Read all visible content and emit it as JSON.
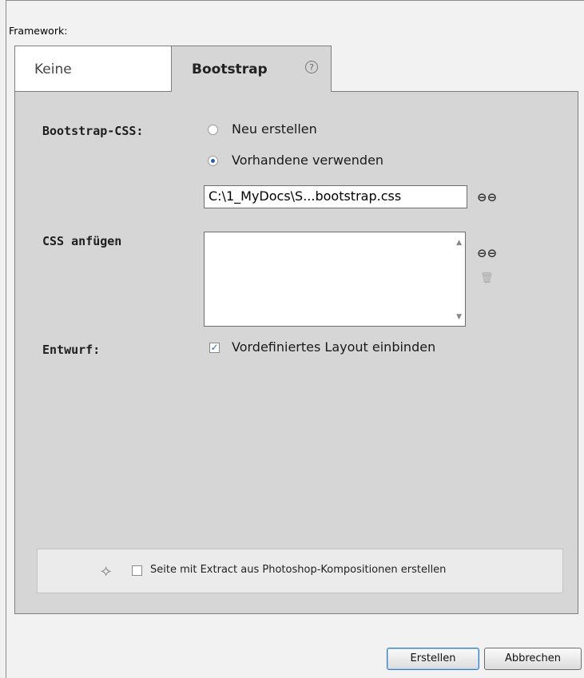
{
  "framework_label": "Framework:",
  "tabs": [
    {
      "label": "Keine",
      "active": false
    },
    {
      "label": "Bootstrap",
      "active": true,
      "help": "?"
    }
  ],
  "bootstrap_css": {
    "label": "Bootstrap-CSS:",
    "options": [
      {
        "label": "Neu erstellen",
        "selected": false
      },
      {
        "label": "Vorhandene verwenden",
        "selected": true
      }
    ],
    "path_value": "C:\\1_MyDocs\\S...bootstrap.css"
  },
  "css_attach": {
    "label": "CSS anfügen"
  },
  "design": {
    "label": "Entwurf:",
    "checkbox_label": "Vordefiniertes Layout einbinden",
    "checked": true
  },
  "extract": {
    "checkbox_label": "Seite mit Extract aus Photoshop-Kompositionen erstellen",
    "checked": false
  },
  "buttons": {
    "create": "Erstellen",
    "cancel": "Abbrechen"
  },
  "icons": {
    "link": "link-icon",
    "trash": "trash-icon",
    "layers": "layers-icon",
    "help": "help-icon"
  },
  "colors": {
    "accent": "#2a5fb0",
    "panel_bg": "#d6d6d6"
  }
}
